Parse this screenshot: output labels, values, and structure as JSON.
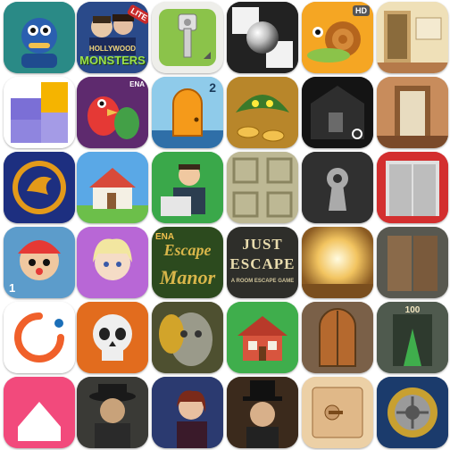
{
  "icons": {
    "hollywood_monsters": {
      "title_line1": "HOLLYWOOD",
      "title_line2": "MONSTERS",
      "badge": "LITE"
    },
    "snail_game": {
      "badge": "HD"
    },
    "doors_two": {
      "number": "2"
    },
    "escape_manor": {
      "badge": "ENA",
      "line1": "Escape",
      "line2": "Manor"
    },
    "just_escape": {
      "line1": "JUST",
      "line2": "ESCAPE",
      "line3": "A ROOM ESCAPE GAME"
    },
    "parrot_game": {
      "badge": "ENA"
    },
    "clown_game": {
      "number": "1"
    },
    "doors_100": {
      "label": "100"
    }
  },
  "colors": {
    "background": "#ffffff"
  }
}
